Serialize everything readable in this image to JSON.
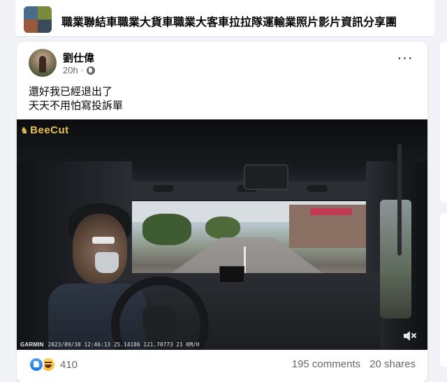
{
  "group": {
    "name": "職業聯結車職業大貨車職業大客車拉拉隊運輸業照片影片資訊分享團"
  },
  "post": {
    "author": "劉仕偉",
    "time": "20h",
    "separator": "·",
    "privacy_icon": "globe-icon",
    "more_label": "···",
    "lines": [
      "還好我已經退出了",
      "天天不用怕寫投訴單"
    ]
  },
  "video": {
    "watermark": "BeeCut",
    "watermark_symbol": "♞",
    "dashcam_brand": "GARMIN",
    "dashcam_stamp": "2023/09/30 12:46:13  25.14186 121.70773  21 KM/H",
    "mute_icon": "speaker-muted-icon"
  },
  "footer": {
    "reaction_icons": [
      "like-icon",
      "haha-icon"
    ],
    "reaction_count": "410",
    "comments": "195 comments",
    "shares": "20 shares"
  },
  "colors": {
    "background": "#f0f2f5",
    "card": "#ffffff",
    "secondary_text": "#65676b",
    "like_blue": "#1877f2",
    "watermark_gold": "#e8c24a"
  }
}
